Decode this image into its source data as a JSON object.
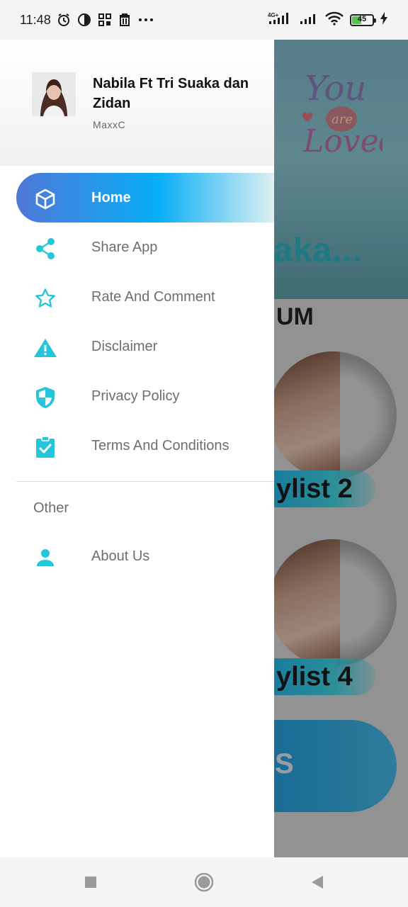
{
  "status_bar": {
    "time": "11:48",
    "battery_level": "45",
    "icons": [
      "alarm-icon",
      "data-saver-icon",
      "grid-icon",
      "trash-icon",
      "more-icon",
      "signal-4g-icon",
      "signal-icon",
      "wifi-icon",
      "battery-icon",
      "charging-icon"
    ]
  },
  "drawer": {
    "title": "Nabila Ft Tri Suaka dan Zidan",
    "subtitle": "MaxxC",
    "menu_items": [
      {
        "label": "Home",
        "icon": "home-cube-icon",
        "active": true
      },
      {
        "label": "Share App",
        "icon": "share-icon",
        "active": false
      },
      {
        "label": "Rate And Comment",
        "icon": "star-icon",
        "active": false
      },
      {
        "label": "Disclaimer",
        "icon": "warning-icon",
        "active": false
      },
      {
        "label": "Privacy Policy",
        "icon": "shield-icon",
        "active": false
      },
      {
        "label": "Terms And Conditions",
        "icon": "clipboard-check-icon",
        "active": false
      }
    ],
    "section_header": "Other",
    "other_items": [
      {
        "label": "About Us",
        "icon": "person-icon"
      }
    ]
  },
  "background": {
    "banner_text": "aka...",
    "album_heading": "UM",
    "cards": [
      {
        "label": "ylist 2"
      },
      {
        "label": "ylist 4"
      }
    ],
    "pill_text": "S"
  },
  "colors": {
    "accent_teal": "#26c6da",
    "active_gradient_start": "#4f78d8",
    "active_gradient_mid": "#07aef6"
  }
}
